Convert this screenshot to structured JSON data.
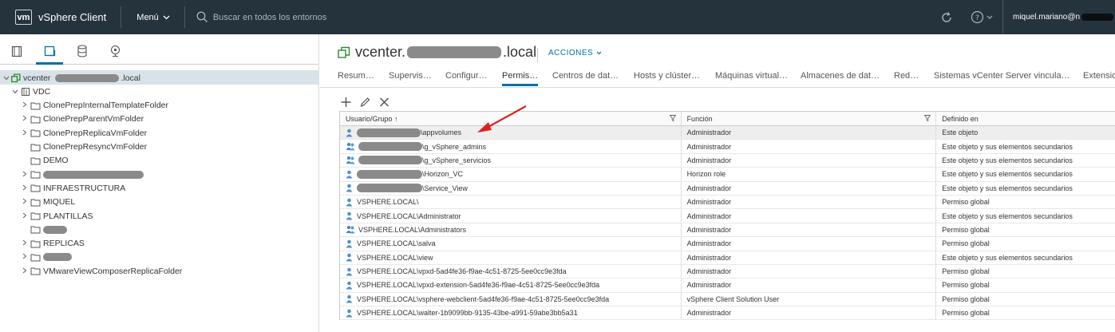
{
  "header": {
    "logo": "vm",
    "app_title": "vSphere Client",
    "menu_label": "Menú",
    "search_placeholder": "Buscar en todos los entornos",
    "user": "miquel.mariano@n"
  },
  "left_panel": {
    "tree": [
      {
        "label": "vcenter",
        "suffix": ".local",
        "icon": "vcenter-icon",
        "level": 0,
        "chevron": "down",
        "selected": true
      },
      {
        "label": "VDC",
        "icon": "datacenter-icon",
        "level": 1,
        "chevron": "down"
      },
      {
        "label": "ClonePrepInternalTemplateFolder",
        "icon": "folder-icon",
        "level": 2,
        "chevron": "right"
      },
      {
        "label": "ClonePrepParentVmFolder",
        "icon": "folder-icon",
        "level": 2,
        "chevron": "right"
      },
      {
        "label": "ClonePrepReplicaVmFolder",
        "icon": "folder-icon",
        "level": 2,
        "chevron": "right"
      },
      {
        "label": "ClonePrepResyncVmFolder",
        "icon": "folder-icon",
        "level": 2,
        "chevron": "none"
      },
      {
        "label": "DEMO",
        "icon": "folder-icon",
        "level": 2,
        "chevron": "none"
      },
      {
        "label": "",
        "icon": "folder-icon",
        "level": 2,
        "chevron": "right"
      },
      {
        "label": "INFRAESTRUCTURA",
        "icon": "folder-icon",
        "level": 2,
        "chevron": "right"
      },
      {
        "label": "MIQUEL",
        "icon": "folder-icon",
        "level": 2,
        "chevron": "right"
      },
      {
        "label": "PLANTILLAS",
        "icon": "folder-icon",
        "level": 2,
        "chevron": "right"
      },
      {
        "label": "",
        "icon": "folder-icon",
        "level": 2,
        "chevron": "none"
      },
      {
        "label": "REPLICAS",
        "icon": "folder-icon",
        "level": 2,
        "chevron": "right"
      },
      {
        "label": "",
        "icon": "folder-icon",
        "level": 2,
        "chevron": "right"
      },
      {
        "label": "VMwareViewComposerReplicaFolder",
        "icon": "folder-icon",
        "level": 2,
        "chevron": "right"
      }
    ]
  },
  "object": {
    "title_prefix": "vcenter.",
    "title_suffix": ".local",
    "actions_label": "ACCIONES"
  },
  "tabs": [
    {
      "label": "Resum…"
    },
    {
      "label": "Supervis…"
    },
    {
      "label": "Configur…"
    },
    {
      "label": "Permis…",
      "active": true
    },
    {
      "label": "Centros de dat…"
    },
    {
      "label": "Hosts y clúster…"
    },
    {
      "label": "Máquinas virtual…"
    },
    {
      "label": "Almacenes de dat…"
    },
    {
      "label": "Red…"
    },
    {
      "label": "Sistemas vCenter Server vincula…"
    },
    {
      "label": "Extensio"
    }
  ],
  "grid": {
    "columns": [
      "Usuario/Grupo ↑",
      "Función",
      "Definido en"
    ],
    "rows": [
      {
        "user": "\\appvolumes",
        "redacted": true,
        "type": "user",
        "role": "Administrador",
        "defined": "Este objeto",
        "selected": true
      },
      {
        "user": "\\g_vSphere_admins",
        "redacted": true,
        "type": "group",
        "role": "Administrador",
        "defined": "Este objeto y sus elementos secundarios"
      },
      {
        "user": "\\g_vSphere_servicios",
        "redacted": true,
        "type": "group",
        "role": "Administrador",
        "defined": "Este objeto y sus elementos secundarios"
      },
      {
        "user": "\\Horizon_VC",
        "redacted": true,
        "type": "user",
        "role": "Horizon role",
        "defined": "Este objeto y sus elementos secundarios"
      },
      {
        "user": "\\Service_View",
        "redacted": true,
        "type": "user",
        "role": "Administrador",
        "defined": "Este objeto y sus elementos secundarios"
      },
      {
        "user": "VSPHERE.LOCAL\\",
        "type": "user",
        "role": "Administrador",
        "defined": "Permiso global"
      },
      {
        "user": "VSPHERE.LOCAL\\Administrator",
        "type": "user",
        "role": "Administrador",
        "defined": "Este objeto y sus elementos secundarios"
      },
      {
        "user": "VSPHERE.LOCAL\\Administrators",
        "type": "group",
        "role": "Administrador",
        "defined": "Permiso global"
      },
      {
        "user": "VSPHERE.LOCAL\\salva",
        "type": "user",
        "role": "Administrador",
        "defined": "Permiso global"
      },
      {
        "user": "VSPHERE.LOCAL\\view",
        "type": "user",
        "role": "Administrador",
        "defined": "Este objeto y sus elementos secundarios"
      },
      {
        "user": "VSPHERE.LOCAL\\vpxd-5ad4fe36-f9ae-4c51-8725-5ee0cc9e3fda",
        "type": "user",
        "role": "Administrador",
        "defined": "Permiso global"
      },
      {
        "user": "VSPHERE.LOCAL\\vpxd-extension-5ad4fe36-f9ae-4c51-8725-5ee0cc9e3fda",
        "type": "user",
        "role": "Administrador",
        "defined": "Permiso global"
      },
      {
        "user": "VSPHERE.LOCAL\\vsphere-webclient-5ad4fe36-f9ae-4c51-8725-5ee0cc9e3fda",
        "type": "user",
        "role": "vSphere Client Solution User",
        "defined": "Permiso global"
      },
      {
        "user": "VSPHERE.LOCAL\\walter-1b9099bb-9135-43be-a991-59abe3bb5a31",
        "type": "user",
        "role": "Administrador",
        "defined": "Permiso global"
      }
    ]
  },
  "colors": {
    "header_bg": "#25333d",
    "accent": "#0072a3",
    "selection": "#d8e3e9",
    "annotation_arrow": "#e02020",
    "user_icon": "#4a90d9"
  }
}
